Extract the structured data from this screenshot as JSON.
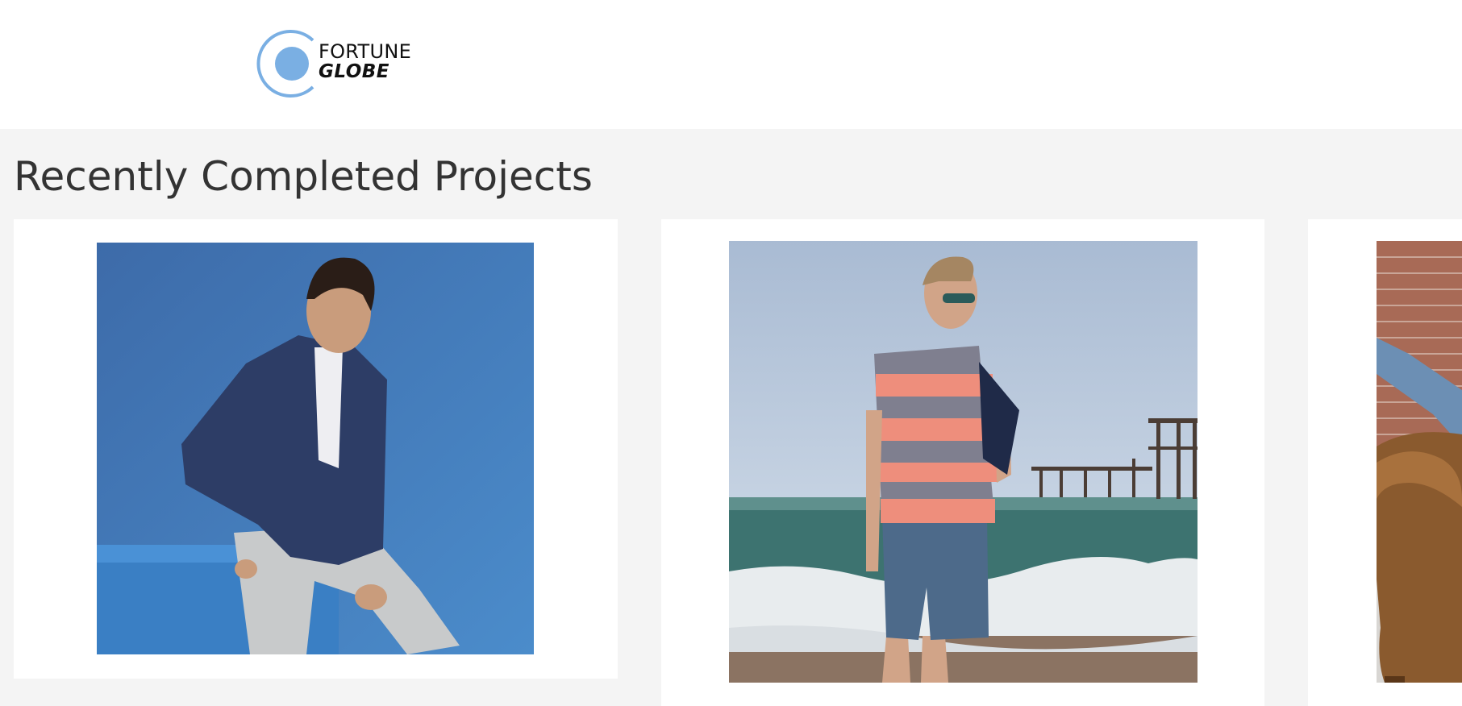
{
  "brand": {
    "logo_line1": "FORTUNE",
    "logo_line2": "GLOBE",
    "accent_color": "#7aafe3"
  },
  "section": {
    "title": "Recently Completed Projects"
  },
  "projects": [
    {
      "image_alt": "Man in navy blazer and grey trousers seated against blue backdrop"
    },
    {
      "image_alt": "Man in striped polo shirt and denim shorts walking on a beach by a pier"
    },
    {
      "image_alt": "Person in jeans sitting on a brown leather armchair against a brick wall"
    }
  ]
}
